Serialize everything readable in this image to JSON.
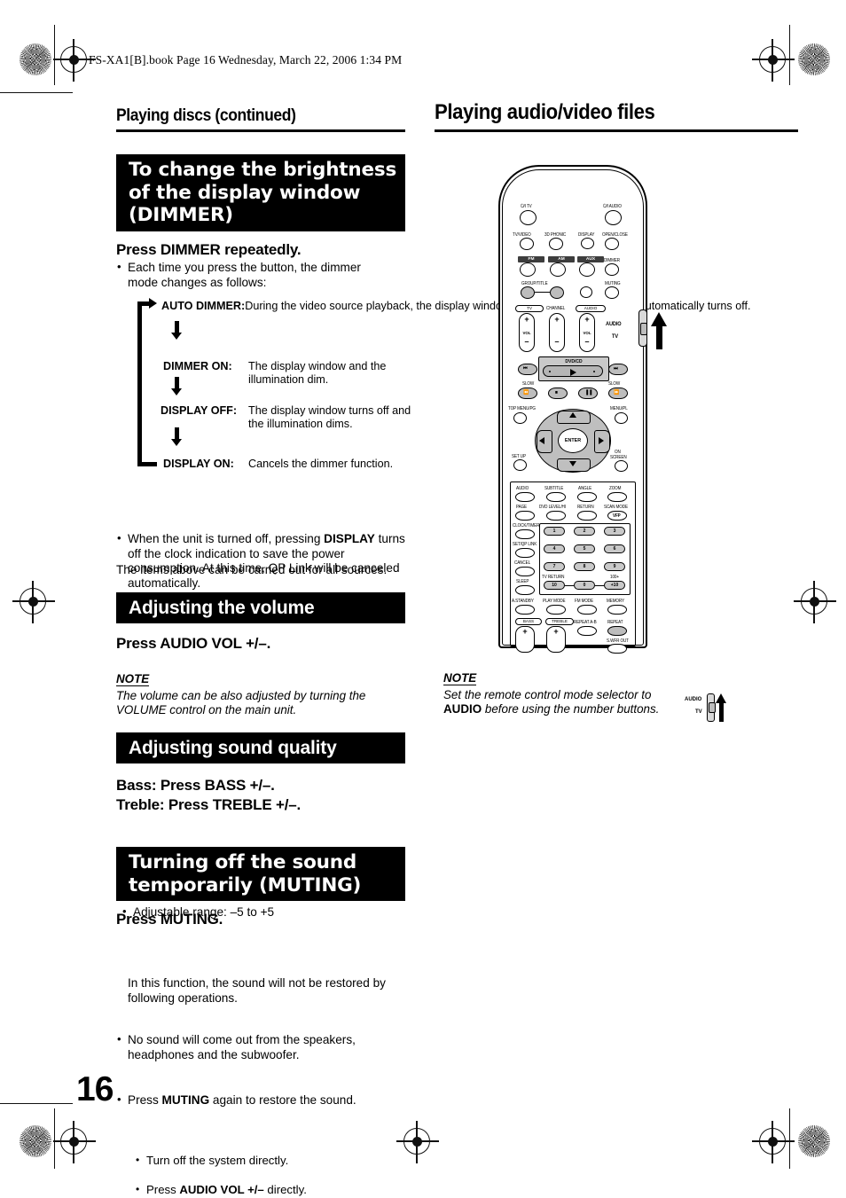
{
  "page": {
    "book_line": "FS-XA1[B].book  Page 16  Wednesday, March 22, 2006  1:34 PM",
    "number": "16"
  },
  "left_column": {
    "running_head": "Playing discs (continued)",
    "dimmer_section": {
      "heading": "To change the brightness of the display window (DIMMER)",
      "instruction": "Press DIMMER repeatedly.",
      "bullet": "Each time you press the button, the dimmer mode changes as follows:",
      "flow": [
        {
          "label": "AUTO DIMMER:",
          "desc": "During the video source playback, the display window dims and the illumination automatically turns off."
        },
        {
          "label": "DIMMER ON:",
          "desc": "The display window and the illumination dim."
        },
        {
          "label": "DISPLAY OFF:",
          "desc": "The display window turns off and the illumination dims."
        },
        {
          "label": "DISPLAY ON:",
          "desc": "Cancels the dimmer function."
        }
      ],
      "note_bullet_pre": "When the unit is turned off, pressing ",
      "note_bullet_bold": "DISPLAY",
      "note_bullet_post": " turns off the clock indication to save the power consumption. At this time, QP Link will be canceled automatically.",
      "closing_line": "The items above can be carried out for all sources."
    },
    "volume_section": {
      "heading": "Adjusting the volume",
      "instruction": "Press AUDIO VOL +/–.",
      "note_label": "NOTE",
      "note_text": "The volume can be also adjusted by turning the VOLUME control on the main unit."
    },
    "sound_quality_section": {
      "heading": "Adjusting sound quality",
      "instruction_bass": "Bass: Press BASS +/–.",
      "instruction_treble": "Treble: Press TREBLE +/–.",
      "bullet": "Adjustable range: –5 to +5"
    },
    "muting_section": {
      "heading": "Turning off the sound temporarily (MUTING)",
      "instruction": "Press MUTING.",
      "bullet1": "No sound will come out from the speakers, headphones and the subwoofer.",
      "bullet2_pre": "Press ",
      "bullet2_bold": "MUTING",
      "bullet2_post": " again to restore the sound.",
      "bullet2_line2": "In this function, the sound will not be restored by following operations.",
      "sub1": "Turn off the system directly.",
      "sub2_pre": "Press ",
      "sub2_bold": "AUDIO VOL +/–",
      "sub2_post": "  directly."
    }
  },
  "right_column": {
    "running_head": "Playing audio/video files",
    "note_label": "NOTE",
    "note_pre": "Set the remote control mode selector to ",
    "note_bold": "AUDIO",
    "note_post": " before using the number buttons.",
    "mini_switch": {
      "top": "AUDIO",
      "bottom": "TV"
    }
  },
  "remote": {
    "name": "remote-control-diagram",
    "mode_selector": {
      "top": "AUDIO",
      "bottom": "TV"
    },
    "rows": {
      "power": [
        "⏻/I TV",
        "⏻/I AUDIO"
      ],
      "r2": [
        "TV/VIDEO",
        "3D PHONIC",
        "DISPLAY",
        "OPEN/CLOSE"
      ],
      "r3": [
        "FM",
        "AM",
        "AUX",
        "DIMMER"
      ],
      "r4": [
        "GROUP/TITLE",
        "MUTING"
      ],
      "volume_pads": [
        "TV",
        "CHANNEL",
        "AUDIO"
      ],
      "vol_side_labels": [
        "AUDIO",
        "TV"
      ],
      "transport_bar": "DVD/CD",
      "transport": [
        "⏮",
        "⏭",
        "SLOW",
        "SLOW",
        "◀◀",
        "■",
        "‖",
        "▶▶"
      ],
      "menu": [
        "TOP MENU/PG",
        "MENU/PL",
        "SET UP",
        "ON SCREEN",
        "ENTER"
      ],
      "keypad_r1": [
        "AUDIO",
        "SUBTITLE",
        "ANGLE",
        "ZOOM"
      ],
      "keypad_r2": [
        "PAGE",
        "DVD LEVEL/HI",
        "RETURN",
        "SCAN MODE"
      ],
      "vfp": "VFP",
      "left_col": [
        "CLOCK/TIMER",
        "SET/QP LINK",
        "CANCEL",
        "SLEEP"
      ],
      "numbers": [
        "1",
        "2",
        "3",
        "4",
        "5",
        "6",
        "7",
        "8",
        "9",
        "10",
        "0",
        "+10"
      ],
      "num_labels": [
        "TV RETURN",
        "100+"
      ],
      "keypad_r5": [
        "A.STANDBY",
        "PLAY MODE",
        "FM MODE",
        "MEMORY"
      ],
      "keypad_r6": [
        "BASS",
        "TREBLE",
        "REPEAT A-B",
        "REPEAT"
      ],
      "swfr": "S.WFR OUT"
    }
  }
}
